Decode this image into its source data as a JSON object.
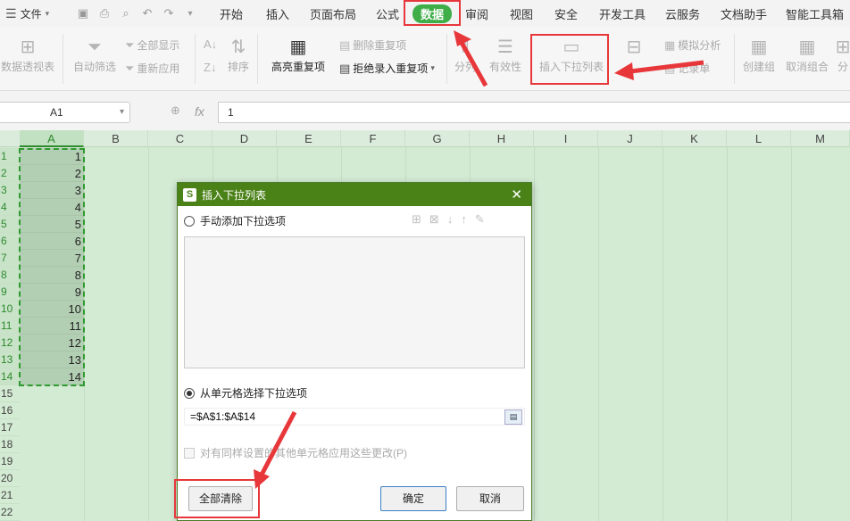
{
  "menu": {
    "file_label": "文件",
    "tabs": [
      "开始",
      "插入",
      "页面布局",
      "公式",
      "数据",
      "审阅",
      "视图",
      "安全",
      "开发工具",
      "云服务",
      "文档助手",
      "智能工具箱"
    ],
    "active_tab": "数据"
  },
  "ribbon": {
    "pivot": "数据透视表",
    "autofilter": "自动筛选",
    "show_all": "全部显示",
    "reapply": "重新应用",
    "sort": "排序",
    "highlight_dup": "高亮重复项",
    "remove_dup": "删除重复项",
    "reject_dup": "拒绝录入重复项",
    "split": "分列",
    "validity": "有效性",
    "insert_dropdown": "插入下拉列表",
    "merge": "合并计算",
    "simulate": "模拟分析",
    "record": "记录单",
    "group": "创建组",
    "ungroup": "取消组合",
    "subtotal": "分"
  },
  "formula_bar": {
    "cell_ref": "A1",
    "fx": "fx",
    "value": "1"
  },
  "sheet": {
    "columns": [
      "A",
      "B",
      "C",
      "D",
      "E",
      "F",
      "G",
      "H",
      "I",
      "J",
      "K",
      "L",
      "M"
    ],
    "rows": [
      "1",
      "2",
      "3",
      "4",
      "5",
      "6",
      "7",
      "8",
      "9",
      "10",
      "11",
      "12",
      "13",
      "14",
      "15",
      "16",
      "17",
      "18",
      "19",
      "20",
      "21",
      "22"
    ],
    "col_a_values": [
      "1",
      "2",
      "3",
      "4",
      "5",
      "6",
      "7",
      "8",
      "9",
      "10",
      "11",
      "12",
      "13",
      "14"
    ]
  },
  "dialog": {
    "title": "插入下拉列表",
    "option_manual": "手动添加下拉选项",
    "option_from_cells": "从单元格选择下拉选项",
    "range_value": "=$A$1:$A$14",
    "apply_same": "对有同样设置的其他单元格应用这些更改(P)",
    "clear_all": "全部清除",
    "ok": "确定",
    "cancel": "取消"
  },
  "colors": {
    "accent_green": "#3fae49",
    "dialog_title": "#4b8218",
    "annotation_red": "#e8373a"
  }
}
